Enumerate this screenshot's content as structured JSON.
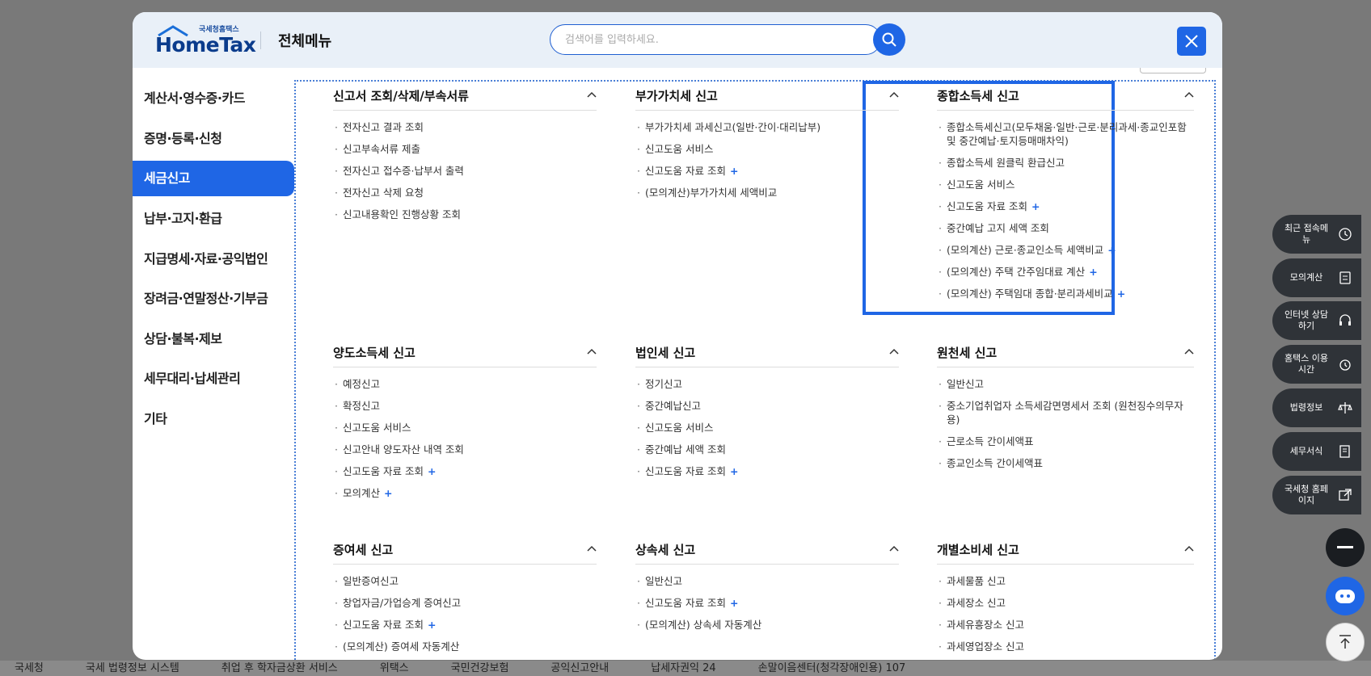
{
  "footer": [
    "국세청",
    "국세 법령정보 시스템",
    "취업 후 학자금상환 서비스",
    "위택스",
    "국민건강보험",
    "공익신고안내",
    "납세자권익 24",
    "손말이음센터(청각장애인용) 107"
  ],
  "logo": {
    "small": "국세청홈택스",
    "big": "HomeTax"
  },
  "header": {
    "title": "전체메뉴",
    "search_placeholder": "검색어를 입력하세요."
  },
  "sidebar": [
    {
      "label": "계산서·영수증·카드",
      "active": false
    },
    {
      "label": "증명·등록·신청",
      "active": false
    },
    {
      "label": "세금신고",
      "active": true
    },
    {
      "label": "납부·고지·환급",
      "active": false
    },
    {
      "label": "지급명세·자료·공익법인",
      "active": false
    },
    {
      "label": "장려금·연말정산·기부금",
      "active": false
    },
    {
      "label": "상담·불복·제보",
      "active": false
    },
    {
      "label": "세무대리·납세관리",
      "active": false
    },
    {
      "label": "기타",
      "active": false
    }
  ],
  "sections": [
    {
      "title": "신고서 조회/삭제/부속서류",
      "items": [
        {
          "label": "전자신고 결과 조회"
        },
        {
          "label": "신고부속서류 제출"
        },
        {
          "label": "전자신고 접수증·납부서 출력"
        },
        {
          "label": "전자신고 삭제 요청"
        },
        {
          "label": "신고내용확인 진행상황 조회"
        }
      ]
    },
    {
      "title": "부가가치세 신고",
      "items": [
        {
          "label": "부가가치세 과세신고(일반·간이·대리납부)"
        },
        {
          "label": "신고도움 서비스"
        },
        {
          "label": "신고도움 자료 조회",
          "plus": "+"
        },
        {
          "label": "(모의계산)부가가치세 세액비교"
        }
      ]
    },
    {
      "title": "종합소득세 신고",
      "items": [
        {
          "label": "종합소득세신고(모두채움·일반·근로·분리과세·종교인포함 및 중간예납·토지등매매차익)"
        },
        {
          "label": "종합소득세 원클릭 환급신고"
        },
        {
          "label": "신고도움 서비스"
        },
        {
          "label": "신고도움 자료 조회",
          "plus": "+"
        },
        {
          "label": "중간예납 고지 세액 조회"
        },
        {
          "label": "(모의계산) 근로·종교인소득 세액비교",
          "plus": "+"
        },
        {
          "label": "(모의계산) 주택 간주임대료 계산",
          "plus": "+"
        },
        {
          "label": "(모의계산) 주택임대 종합·분리과세비교",
          "plus": "+"
        }
      ]
    },
    {
      "title": "양도소득세 신고",
      "items": [
        {
          "label": "예정신고"
        },
        {
          "label": "확정신고"
        },
        {
          "label": "신고도움 서비스"
        },
        {
          "label": "신고안내 양도자산 내역 조회"
        },
        {
          "label": "신고도움 자료 조회",
          "plus": "+"
        },
        {
          "label": "모의계산",
          "plus": "+"
        }
      ]
    },
    {
      "title": "법인세 신고",
      "items": [
        {
          "label": "정기신고"
        },
        {
          "label": "중간예납신고"
        },
        {
          "label": "신고도움 서비스"
        },
        {
          "label": "중간예납 세액 조회"
        },
        {
          "label": "신고도움 자료 조회",
          "plus": "+"
        }
      ]
    },
    {
      "title": "원천세 신고",
      "items": [
        {
          "label": "일반신고"
        },
        {
          "label": "중소기업취업자 소득세감면명세서 조회 (원천징수의무자용)"
        },
        {
          "label": "근로소득 간이세액표"
        },
        {
          "label": "종교인소득 간이세액표"
        }
      ]
    },
    {
      "title": "증여세 신고",
      "items": [
        {
          "label": "일반증여신고"
        },
        {
          "label": "창업자금/가업승계 증여신고"
        },
        {
          "label": "신고도움 자료 조회",
          "plus": "+"
        },
        {
          "label": "(모의계산) 증여세 자동계산"
        }
      ]
    },
    {
      "title": "상속세 신고",
      "items": [
        {
          "label": "일반신고"
        },
        {
          "label": "신고도움 자료 조회",
          "plus": "+"
        },
        {
          "label": "(모의계산) 상속세 자동계산"
        }
      ]
    },
    {
      "title": "개별소비세 신고",
      "items": [
        {
          "label": "과세물품 신고"
        },
        {
          "label": "과세장소 신고"
        },
        {
          "label": "과세유흥장소 신고"
        },
        {
          "label": "과세영업장소 신고"
        }
      ]
    }
  ],
  "quick_menu": [
    {
      "label": "최근 접속메뉴",
      "icon": "clock-icon"
    },
    {
      "label": "모의계산",
      "icon": "calculator-icon"
    },
    {
      "label": "인터넷 상담하기",
      "icon": "headset-icon"
    },
    {
      "label": "홈택스 이용시간",
      "icon": "alarm-icon"
    },
    {
      "label": "법령정보",
      "icon": "scale-icon"
    },
    {
      "label": "세무서식",
      "icon": "form-edit-icon"
    },
    {
      "label": "국세청 홈페이지",
      "icon": "external-link-icon"
    }
  ],
  "colors": {
    "accent": "#1f66e5",
    "dark": "#2f3338",
    "header_bg": "#e9f0f8"
  }
}
